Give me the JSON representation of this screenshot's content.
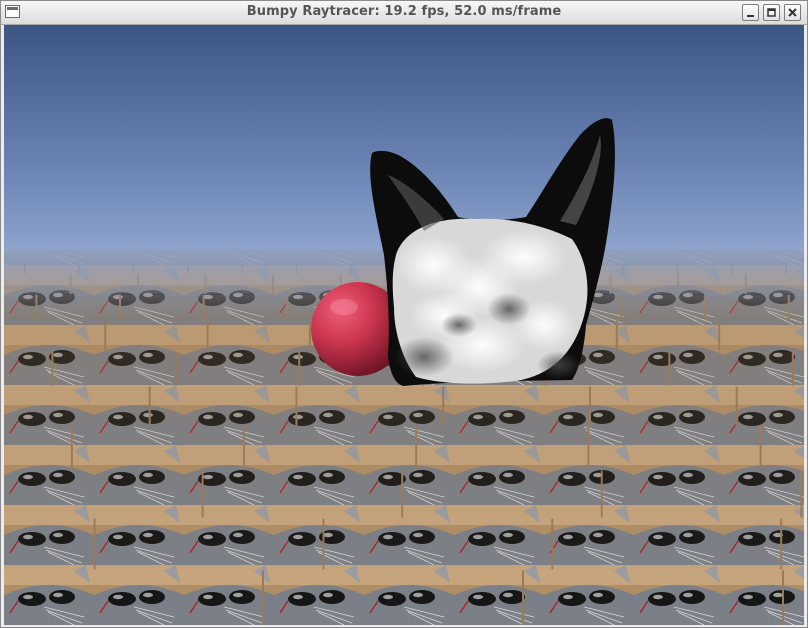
{
  "window": {
    "title": "Bumpy Raytracer: 19.2 fps, 52.0 ms/frame",
    "controls": {
      "minimize_icon": "minimize-icon",
      "maximize_icon": "maximize-icon",
      "close_icon": "close-icon",
      "menu_icon": "window-menu-icon"
    }
  },
  "scene": {
    "sky_top_color": "#3d5584",
    "sky_horizon_color": "#8fa6cf",
    "sphere_color": "#c9344c",
    "cat_head_colors": [
      "#0a0a0a",
      "#f2f2f2"
    ],
    "floor_texture_tones": [
      "#8c6a45",
      "#c3a27b",
      "#5a5f6a",
      "#1c1c1c"
    ]
  }
}
